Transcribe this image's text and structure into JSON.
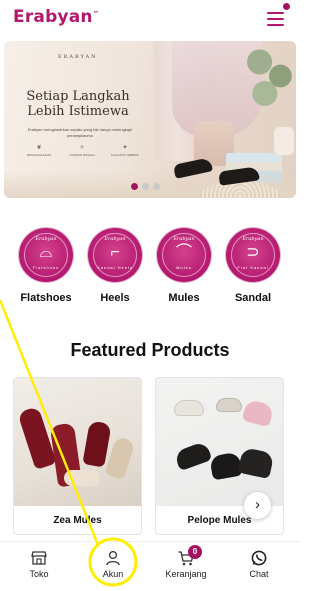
{
  "header": {
    "brand": "Erabyan",
    "brand_mark": "™",
    "menu_icon": "hamburger-icon",
    "accent_color": "#b3186e"
  },
  "banner": {
    "brand": "ERABYAN",
    "title": "Setiap Langkah Lebih Istimewa",
    "description": "Erabyan menghadirkan sepatu yang tak hanya melengkapi penampilanmu",
    "features": [
      {
        "icon": "leaf-icon",
        "label": "DESIGN ELEGAN"
      },
      {
        "icon": "feather-icon",
        "label": "NYAMAN DIPAKAI"
      },
      {
        "icon": "star-icon",
        "label": "KUALITAS TERBAIK"
      }
    ],
    "slide_count": 3,
    "active_slide": 1
  },
  "categories": [
    {
      "name": "Flatshoes",
      "mini_label": "Flatshoes"
    },
    {
      "name": "Heels",
      "mini_label": "Sandal Heels"
    },
    {
      "name": "Mules",
      "mini_label": "Mules"
    },
    {
      "name": "Sandal",
      "mini_label": "Flat Sandal"
    }
  ],
  "category_badge_text": "Erabyan",
  "featured": {
    "title": "Featured Products",
    "products": [
      {
        "name": "Zea Mules"
      },
      {
        "name": "Pelope Mules"
      }
    ],
    "next_icon": "chevron-right-icon"
  },
  "bottom_nav": {
    "items": [
      {
        "label": "Toko",
        "icon": "store-icon"
      },
      {
        "label": "Akun",
        "icon": "user-icon"
      },
      {
        "label": "Keranjang",
        "icon": "cart-icon",
        "badge": "0"
      },
      {
        "label": "Chat",
        "icon": "whatsapp-icon"
      }
    ]
  },
  "colors": {
    "brand": "#b3186e",
    "dot_active": "#a3145f",
    "annotation": "#ffee00"
  }
}
